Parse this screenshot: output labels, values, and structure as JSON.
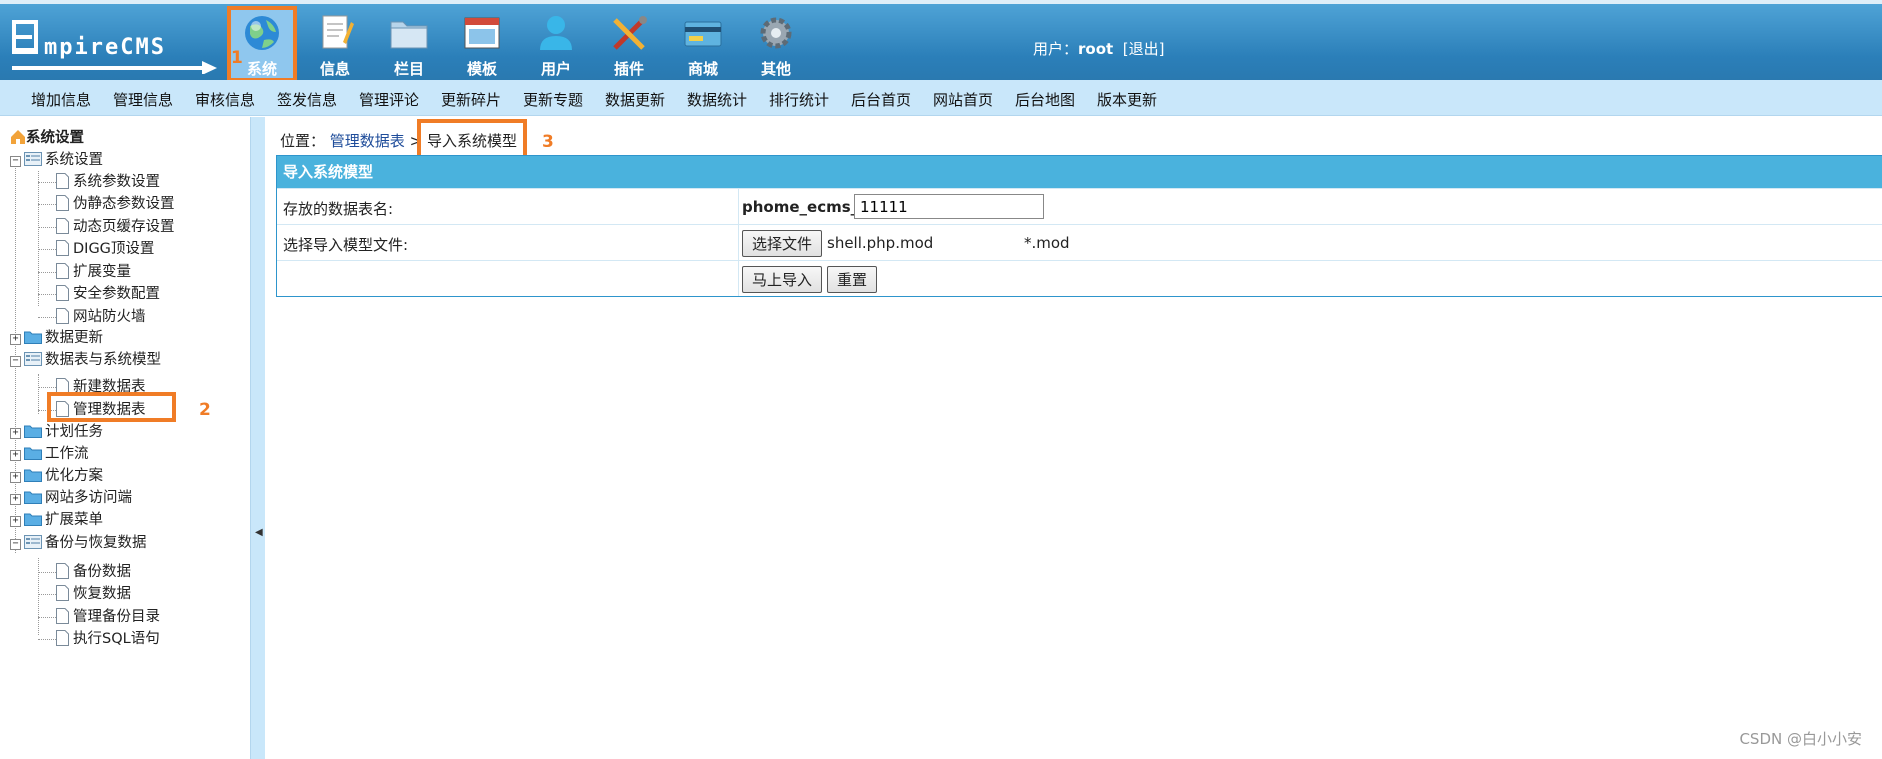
{
  "header": {
    "logo_text": "EmpireCMS",
    "nav": [
      {
        "label": "系统",
        "icon": "globe-icon"
      },
      {
        "label": "信息",
        "icon": "notepad-icon"
      },
      {
        "label": "栏目",
        "icon": "folder-icon"
      },
      {
        "label": "模板",
        "icon": "window-icon"
      },
      {
        "label": "用户",
        "icon": "user-icon"
      },
      {
        "label": "插件",
        "icon": "tools-icon"
      },
      {
        "label": "商城",
        "icon": "card-icon"
      },
      {
        "label": "其他",
        "icon": "gear-icon"
      }
    ],
    "user_prefix": "用户：",
    "username": "root",
    "logout": "[退出]"
  },
  "menu": [
    "增加信息",
    "管理信息",
    "审核信息",
    "签发信息",
    "管理评论",
    "更新碎片",
    "更新专题",
    "数据更新",
    "数据统计",
    "排行统计",
    "后台首页",
    "网站首页",
    "后台地图",
    "版本更新"
  ],
  "sidebar": {
    "title": "系统设置",
    "nodes": [
      {
        "label": "系统设置",
        "kind": "open"
      },
      {
        "label": "系统参数设置",
        "kind": "leaf"
      },
      {
        "label": "伪静态参数设置",
        "kind": "leaf"
      },
      {
        "label": "动态页缓存设置",
        "kind": "leaf"
      },
      {
        "label": "DIGG顶设置",
        "kind": "leaf"
      },
      {
        "label": "扩展变量",
        "kind": "leaf"
      },
      {
        "label": "安全参数配置",
        "kind": "leaf"
      },
      {
        "label": "网站防火墙",
        "kind": "leaf"
      },
      {
        "label": "数据更新",
        "kind": "closed"
      },
      {
        "label": "数据表与系统模型",
        "kind": "open"
      },
      {
        "label": "新建数据表",
        "kind": "leaf"
      },
      {
        "label": "管理数据表",
        "kind": "leaf"
      },
      {
        "label": "计划任务",
        "kind": "closed"
      },
      {
        "label": "工作流",
        "kind": "closed"
      },
      {
        "label": "优化方案",
        "kind": "closed"
      },
      {
        "label": "网站多访问端",
        "kind": "closed"
      },
      {
        "label": "扩展菜单",
        "kind": "closed"
      },
      {
        "label": "备份与恢复数据",
        "kind": "open"
      },
      {
        "label": "备份数据",
        "kind": "leaf"
      },
      {
        "label": "恢复数据",
        "kind": "leaf"
      },
      {
        "label": "管理备份目录",
        "kind": "leaf"
      },
      {
        "label": "执行SQL语句",
        "kind": "leaf"
      }
    ]
  },
  "breadcrumb": {
    "prefix": "位置：",
    "link": "管理数据表",
    "sep": ">",
    "current": "导入系统模型"
  },
  "annotations": [
    "1",
    "2",
    "3"
  ],
  "form": {
    "title": "导入系统模型",
    "table_label": "存放的数据表名:",
    "table_prefix": "phome_ecms_",
    "table_value": "11111",
    "file_label": "选择导入模型文件:",
    "choose_button": "选择文件",
    "file_name": "shell.php.mod",
    "file_hint": "*.mod",
    "submit_button": "马上导入",
    "reset_button": "重置"
  },
  "watermark": "CSDN @白小小安",
  "colors": {
    "banner": "#2b7fb9",
    "menubar": "#c9e7fa",
    "highlight": "#f07c26",
    "form_header": "#4ab2dd"
  }
}
